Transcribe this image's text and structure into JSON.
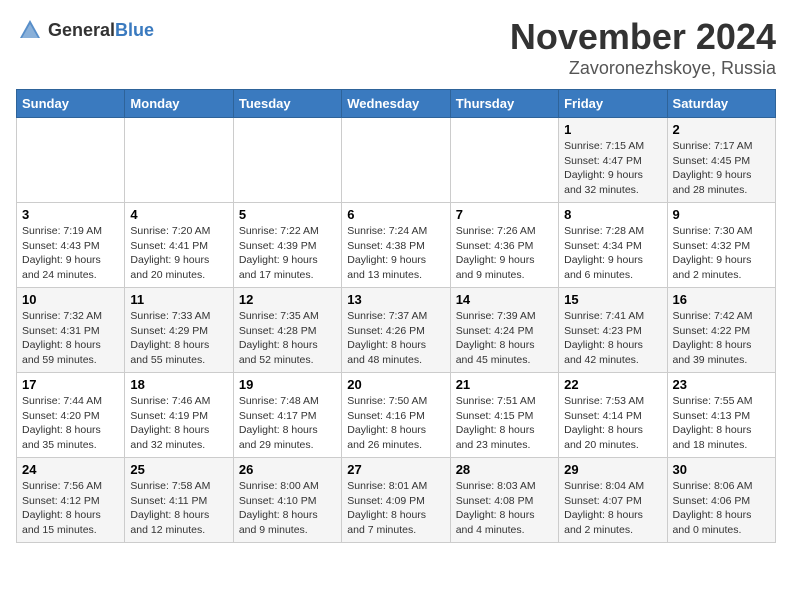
{
  "header": {
    "logo_general": "General",
    "logo_blue": "Blue",
    "month": "November 2024",
    "location": "Zavoronezhskoye, Russia"
  },
  "weekdays": [
    "Sunday",
    "Monday",
    "Tuesday",
    "Wednesday",
    "Thursday",
    "Friday",
    "Saturday"
  ],
  "weeks": [
    [
      {
        "day": "",
        "info": ""
      },
      {
        "day": "",
        "info": ""
      },
      {
        "day": "",
        "info": ""
      },
      {
        "day": "",
        "info": ""
      },
      {
        "day": "",
        "info": ""
      },
      {
        "day": "1",
        "info": "Sunrise: 7:15 AM\nSunset: 4:47 PM\nDaylight: 9 hours\nand 32 minutes."
      },
      {
        "day": "2",
        "info": "Sunrise: 7:17 AM\nSunset: 4:45 PM\nDaylight: 9 hours\nand 28 minutes."
      }
    ],
    [
      {
        "day": "3",
        "info": "Sunrise: 7:19 AM\nSunset: 4:43 PM\nDaylight: 9 hours\nand 24 minutes."
      },
      {
        "day": "4",
        "info": "Sunrise: 7:20 AM\nSunset: 4:41 PM\nDaylight: 9 hours\nand 20 minutes."
      },
      {
        "day": "5",
        "info": "Sunrise: 7:22 AM\nSunset: 4:39 PM\nDaylight: 9 hours\nand 17 minutes."
      },
      {
        "day": "6",
        "info": "Sunrise: 7:24 AM\nSunset: 4:38 PM\nDaylight: 9 hours\nand 13 minutes."
      },
      {
        "day": "7",
        "info": "Sunrise: 7:26 AM\nSunset: 4:36 PM\nDaylight: 9 hours\nand 9 minutes."
      },
      {
        "day": "8",
        "info": "Sunrise: 7:28 AM\nSunset: 4:34 PM\nDaylight: 9 hours\nand 6 minutes."
      },
      {
        "day": "9",
        "info": "Sunrise: 7:30 AM\nSunset: 4:32 PM\nDaylight: 9 hours\nand 2 minutes."
      }
    ],
    [
      {
        "day": "10",
        "info": "Sunrise: 7:32 AM\nSunset: 4:31 PM\nDaylight: 8 hours\nand 59 minutes."
      },
      {
        "day": "11",
        "info": "Sunrise: 7:33 AM\nSunset: 4:29 PM\nDaylight: 8 hours\nand 55 minutes."
      },
      {
        "day": "12",
        "info": "Sunrise: 7:35 AM\nSunset: 4:28 PM\nDaylight: 8 hours\nand 52 minutes."
      },
      {
        "day": "13",
        "info": "Sunrise: 7:37 AM\nSunset: 4:26 PM\nDaylight: 8 hours\nand 48 minutes."
      },
      {
        "day": "14",
        "info": "Sunrise: 7:39 AM\nSunset: 4:24 PM\nDaylight: 8 hours\nand 45 minutes."
      },
      {
        "day": "15",
        "info": "Sunrise: 7:41 AM\nSunset: 4:23 PM\nDaylight: 8 hours\nand 42 minutes."
      },
      {
        "day": "16",
        "info": "Sunrise: 7:42 AM\nSunset: 4:22 PM\nDaylight: 8 hours\nand 39 minutes."
      }
    ],
    [
      {
        "day": "17",
        "info": "Sunrise: 7:44 AM\nSunset: 4:20 PM\nDaylight: 8 hours\nand 35 minutes."
      },
      {
        "day": "18",
        "info": "Sunrise: 7:46 AM\nSunset: 4:19 PM\nDaylight: 8 hours\nand 32 minutes."
      },
      {
        "day": "19",
        "info": "Sunrise: 7:48 AM\nSunset: 4:17 PM\nDaylight: 8 hours\nand 29 minutes."
      },
      {
        "day": "20",
        "info": "Sunrise: 7:50 AM\nSunset: 4:16 PM\nDaylight: 8 hours\nand 26 minutes."
      },
      {
        "day": "21",
        "info": "Sunrise: 7:51 AM\nSunset: 4:15 PM\nDaylight: 8 hours\nand 23 minutes."
      },
      {
        "day": "22",
        "info": "Sunrise: 7:53 AM\nSunset: 4:14 PM\nDaylight: 8 hours\nand 20 minutes."
      },
      {
        "day": "23",
        "info": "Sunrise: 7:55 AM\nSunset: 4:13 PM\nDaylight: 8 hours\nand 18 minutes."
      }
    ],
    [
      {
        "day": "24",
        "info": "Sunrise: 7:56 AM\nSunset: 4:12 PM\nDaylight: 8 hours\nand 15 minutes."
      },
      {
        "day": "25",
        "info": "Sunrise: 7:58 AM\nSunset: 4:11 PM\nDaylight: 8 hours\nand 12 minutes."
      },
      {
        "day": "26",
        "info": "Sunrise: 8:00 AM\nSunset: 4:10 PM\nDaylight: 8 hours\nand 9 minutes."
      },
      {
        "day": "27",
        "info": "Sunrise: 8:01 AM\nSunset: 4:09 PM\nDaylight: 8 hours\nand 7 minutes."
      },
      {
        "day": "28",
        "info": "Sunrise: 8:03 AM\nSunset: 4:08 PM\nDaylight: 8 hours\nand 4 minutes."
      },
      {
        "day": "29",
        "info": "Sunrise: 8:04 AM\nSunset: 4:07 PM\nDaylight: 8 hours\nand 2 minutes."
      },
      {
        "day": "30",
        "info": "Sunrise: 8:06 AM\nSunset: 4:06 PM\nDaylight: 8 hours\nand 0 minutes."
      }
    ]
  ]
}
